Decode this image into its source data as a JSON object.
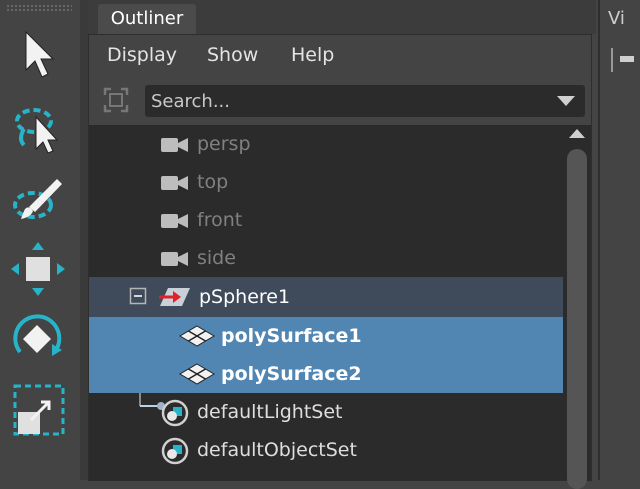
{
  "outliner": {
    "tab_label": "Outliner",
    "menus": [
      "Display",
      "Show",
      "Help"
    ],
    "search": {
      "placeholder": "Search...",
      "value": ""
    },
    "items": [
      {
        "label": "persp",
        "icon": "camera-icon",
        "state": "dim"
      },
      {
        "label": "top",
        "icon": "camera-icon",
        "state": "dim"
      },
      {
        "label": "front",
        "icon": "camera-icon",
        "state": "dim"
      },
      {
        "label": "side",
        "icon": "camera-icon",
        "state": "dim"
      },
      {
        "label": "pSphere1",
        "icon": "transform-icon",
        "state": "expanded-parent"
      },
      {
        "label": "polySurface1",
        "icon": "mesh-icon",
        "state": "selected"
      },
      {
        "label": "polySurface2",
        "icon": "mesh-icon",
        "state": "selected"
      },
      {
        "label": "defaultLightSet",
        "icon": "set-icon",
        "state": "normal"
      },
      {
        "label": "defaultObjectSet",
        "icon": "set-icon",
        "state": "normal"
      }
    ],
    "expand_toggle": "⊟"
  },
  "viewport": {
    "tab_label_partial": "Vi"
  },
  "toolbox": {
    "tools": [
      "select-arrow-icon",
      "lasso-select-icon",
      "paint-select-icon",
      "move-tool-icon",
      "rotate-tool-icon",
      "scale-tool-icon"
    ]
  },
  "colors": {
    "selection": "#5286b2",
    "parent_highlight": "#3f4b5a",
    "tool_accent": "#27b4c8",
    "tree_bg": "#2b2b2b"
  }
}
